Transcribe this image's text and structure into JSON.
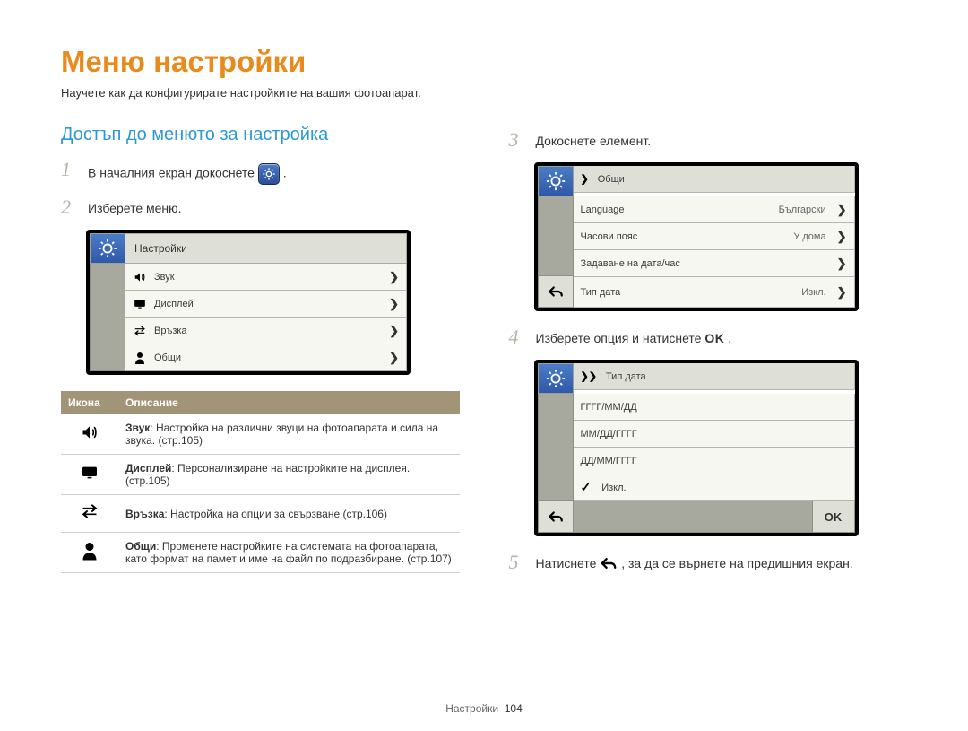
{
  "title": "Меню настройки",
  "subtitle": "Научете как да конфигурирате настройките на вашия фотоапарат.",
  "section_title": "Достъп до менюто за настройка",
  "steps": {
    "s1": {
      "num": "1",
      "text_before": "В началния екран докоснете ",
      "text_after": "."
    },
    "s2": {
      "num": "2",
      "text": "Изберете меню."
    },
    "s3": {
      "num": "3",
      "text": "Докоснете елемент."
    },
    "s4": {
      "num": "4",
      "text_before": "Изберете опция и натиснете ",
      "ok": "OK",
      "text_after": "."
    },
    "s5": {
      "num": "5",
      "text_before": "Натиснете ",
      "text_after": ", за да се върнете на предишния екран."
    }
  },
  "menu_screen": {
    "header": "Настройки",
    "items": [
      {
        "label": "Звук"
      },
      {
        "label": "Дисплей"
      },
      {
        "label": "Връзка"
      },
      {
        "label": "Общи"
      }
    ]
  },
  "element_screen": {
    "header_pre": "❯",
    "header": "Общи",
    "items": [
      {
        "label": "Language",
        "value": "Български"
      },
      {
        "label": "Часови пояс",
        "value": "У дома"
      },
      {
        "label": "Задаване на дата/час",
        "value": ""
      },
      {
        "label": "Тип дата",
        "value": "Изкл."
      }
    ]
  },
  "option_screen": {
    "header_pre": "❯❯",
    "header": "Тип дата",
    "items": [
      {
        "label": "ГГГГ/ММ/ДД",
        "check": false
      },
      {
        "label": "ММ/ДД/ГГГГ",
        "check": false
      },
      {
        "label": "ДД/ММ/ГГГГ",
        "check": false
      },
      {
        "label": "Изкл.",
        "check": true
      }
    ],
    "ok": "OK"
  },
  "table": {
    "head": {
      "icon": "Икона",
      "desc": "Описание"
    },
    "rows": [
      {
        "term": "Звук",
        "rest": ": Настройка на различни звуци на фотоапарата и сила на звука. (стр.105)"
      },
      {
        "term": "Дисплей",
        "rest": ": Персонализиране на настройките на дисплея. (стр.105)"
      },
      {
        "term": "Връзка",
        "rest": ": Настройка на опции за свързване (стр.106)"
      },
      {
        "term": "Общи",
        "rest": ": Променете настройките на системата на фотоапарата, като формат на памет и име на файл по подразбиране. (стр.107)"
      }
    ]
  },
  "footer": {
    "label": "Настройки",
    "page": "104"
  }
}
